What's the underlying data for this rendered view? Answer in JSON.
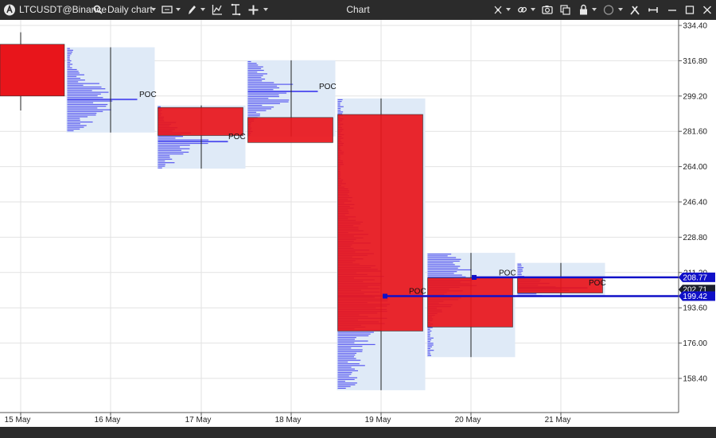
{
  "toolbar": {
    "symbol": "LTCUSDT@Binance",
    "timeframe": "Daily chart",
    "window_title": "Chart",
    "icons": [
      "app-logo-icon",
      "search-icon",
      "chevron-down-icon",
      "monitor-icon",
      "pencil-icon",
      "indicator-icon",
      "template-icon",
      "plus-icon",
      "crosshair-icon",
      "link-icon",
      "camera-icon",
      "clone-icon",
      "lock-icon",
      "circle-icon",
      "tools-icon",
      "pin-icon",
      "minimize-icon",
      "maximize-icon",
      "close-icon"
    ]
  },
  "chart_data": {
    "type": "candlestick-volume-profile",
    "x_tick_labels": [
      "15 May",
      "16 May",
      "17 May",
      "18 May",
      "19 May",
      "20 May",
      "21 May"
    ],
    "y_tick_labels": [
      "334.40",
      "316.80",
      "299.20",
      "281.60",
      "264.00",
      "246.40",
      "228.80",
      "211.20",
      "193.60",
      "176.00",
      "158.40"
    ],
    "ylim": [
      148,
      336
    ],
    "candles": [
      {
        "date": "15 May",
        "open": 325.0,
        "close": 299.2,
        "high": 331.0,
        "low": 292.0
      },
      {
        "date": "16 May",
        "low": 281.0,
        "high": 323.5,
        "poc": 297.5
      },
      {
        "date": "17 May",
        "open": 293.5,
        "close": 279.5,
        "high": 294.5,
        "low": 263.0,
        "poc": 276.5
      },
      {
        "date": "18 May",
        "open": 288.5,
        "close": 276.0,
        "high": 317.0,
        "low": 279.0,
        "poc": 301.5
      },
      {
        "date": "19 May",
        "open": 290.0,
        "close": 182.0,
        "high": 298.0,
        "low": 152.5,
        "poc": 199.5
      },
      {
        "date": "20 May",
        "open": 208.5,
        "close": 184.0,
        "high": 221.0,
        "low": 169.0,
        "poc": 208.5
      },
      {
        "date": "21 May",
        "open": 208.5,
        "close": 201.0,
        "high": 216.0,
        "low": 199.0,
        "poc": 203.5
      }
    ],
    "poc_label": "POC",
    "price_lines": [
      {
        "label": "208.77",
        "value": 208.77,
        "color": "#1010c8"
      },
      {
        "label": "199.42",
        "value": 199.42,
        "color": "#1010c8"
      }
    ],
    "current_price": {
      "label": "202.71",
      "value": 202.71,
      "color": "#1b1f2e"
    },
    "colors": {
      "candle_down": "#e8151b",
      "candle_up_outline": "#222222",
      "profile_bg": "#dfeaf7",
      "profile_bars": "#5a5af0",
      "grid": "#e2e2e2"
    },
    "grid": true
  }
}
